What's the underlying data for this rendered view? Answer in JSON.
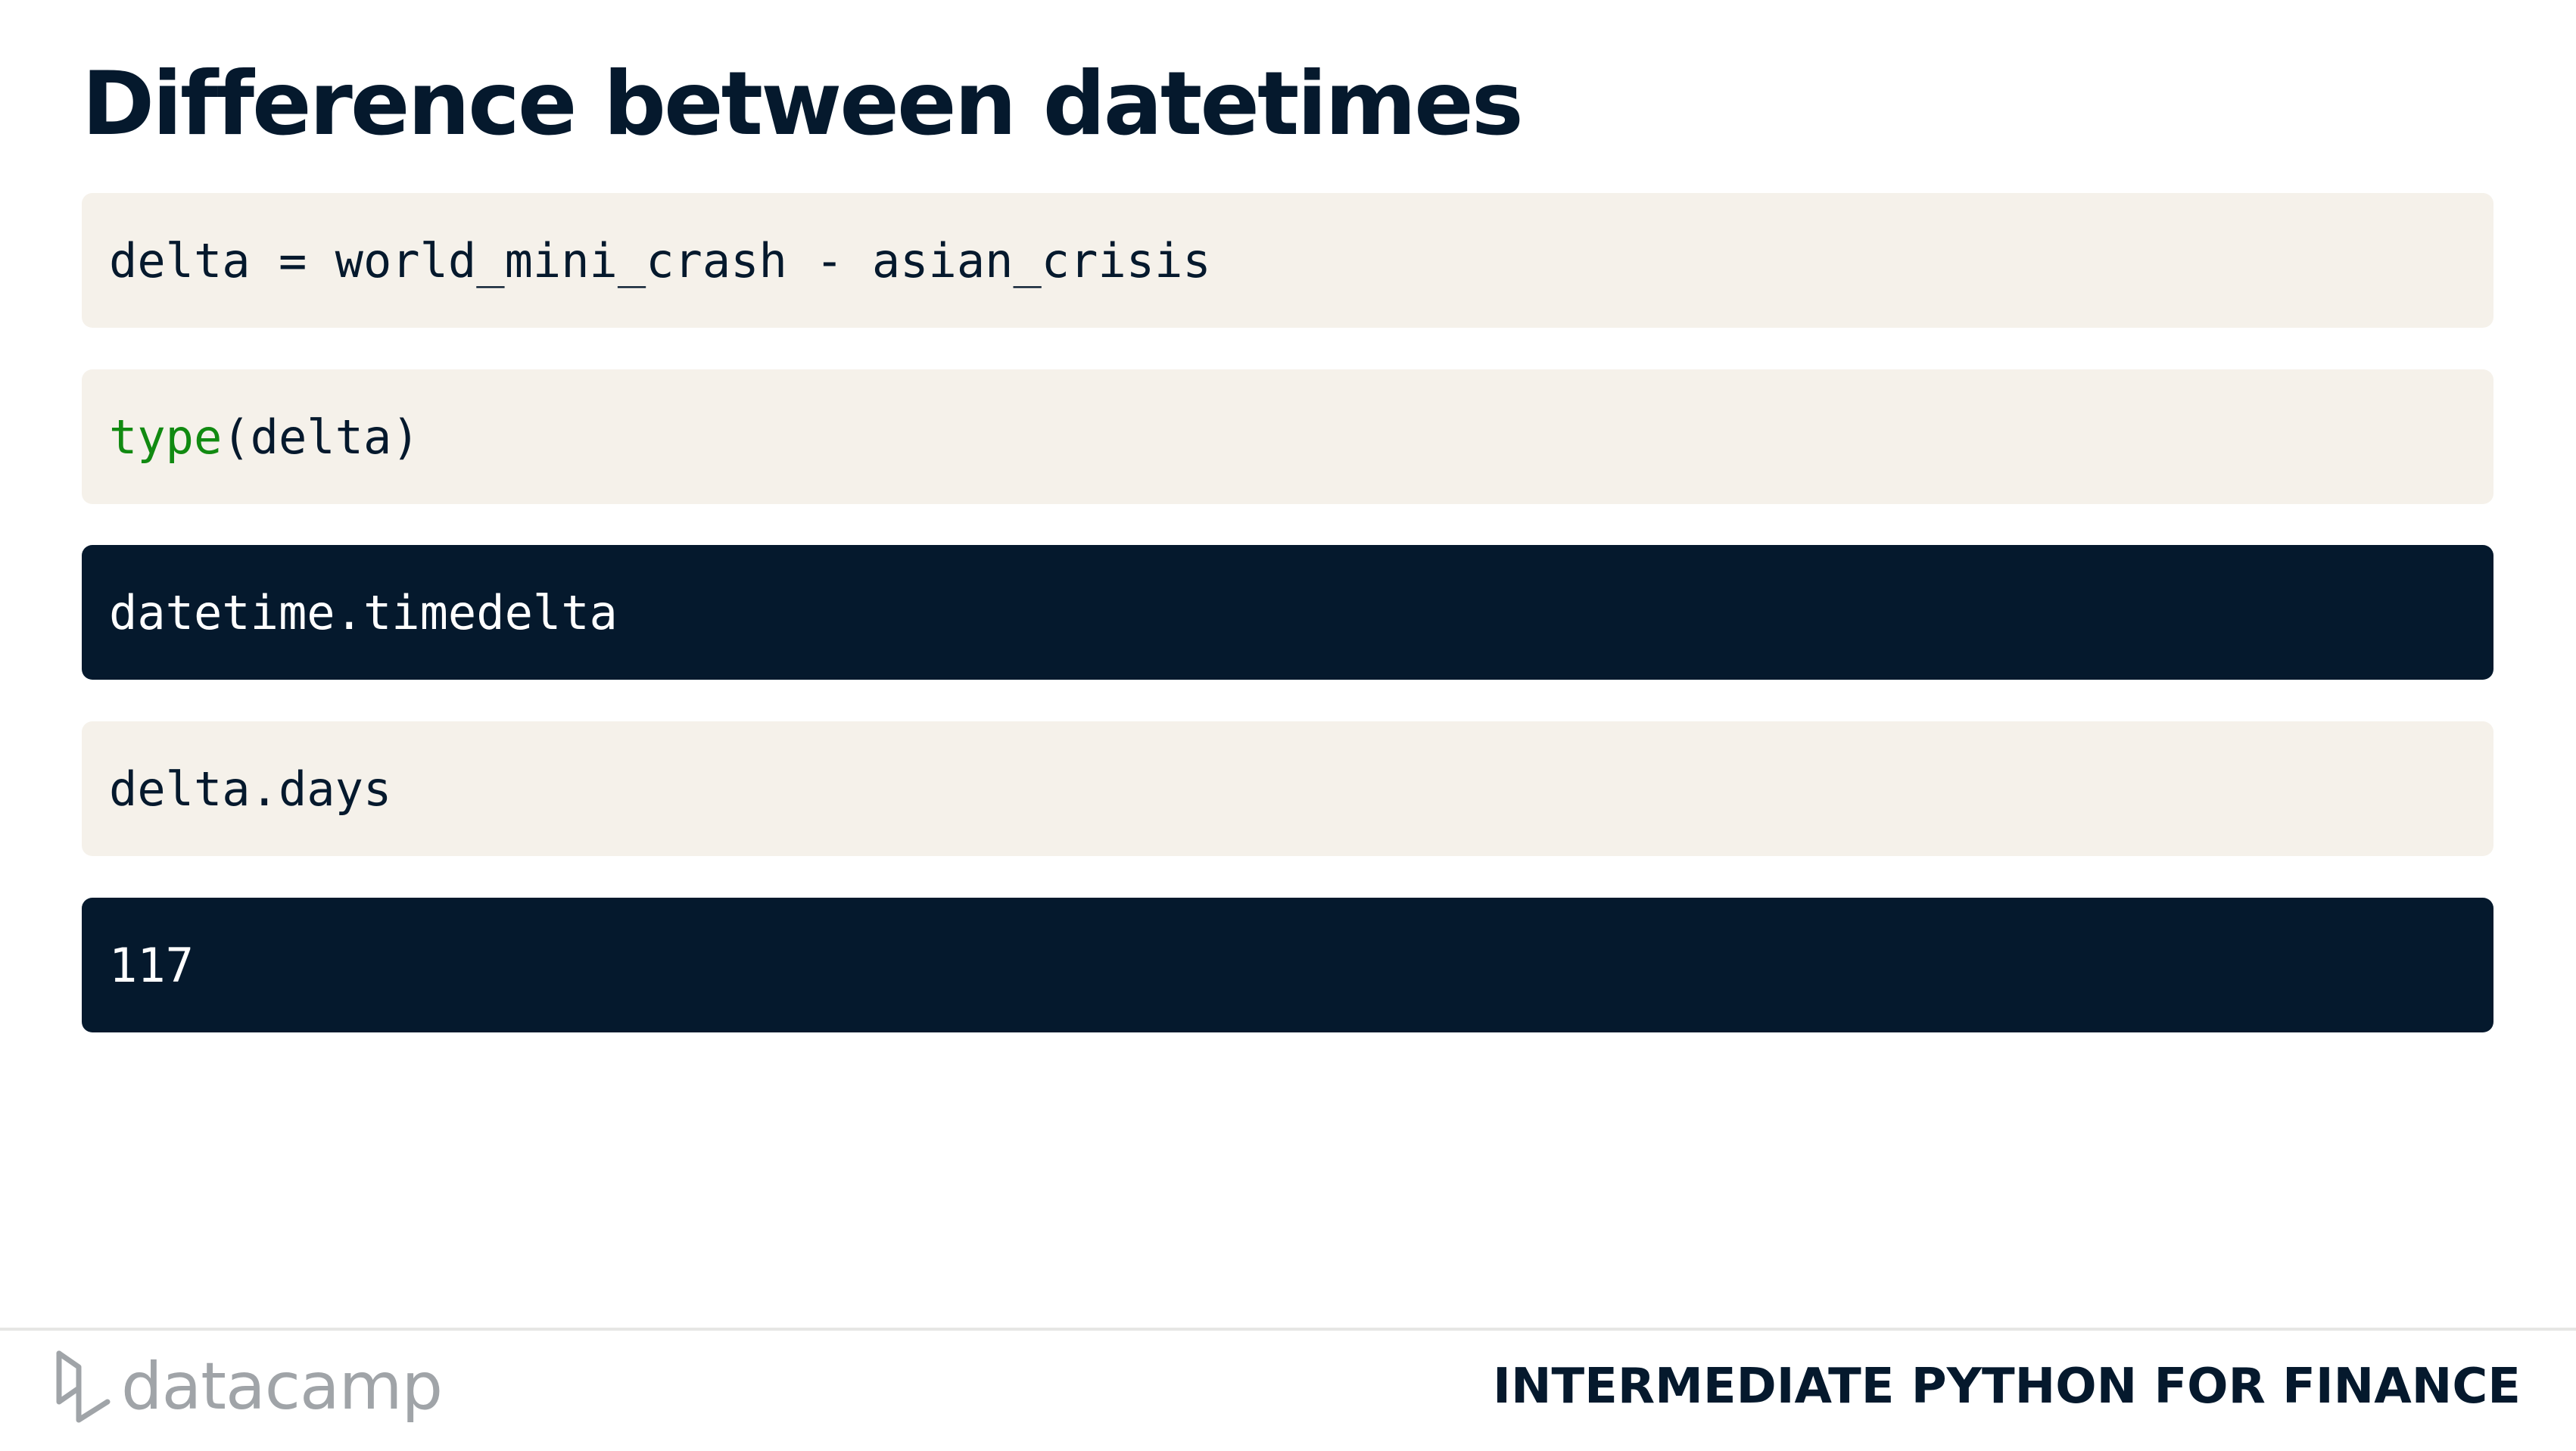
{
  "slide": {
    "title": "Difference between datetimes"
  },
  "blocks": [
    {
      "kind": "code",
      "text": "delta = world_mini_crash - asian_crisis"
    },
    {
      "kind": "code",
      "keyword": "type",
      "rest": "(delta)"
    },
    {
      "kind": "output",
      "text": "datetime.timedelta"
    },
    {
      "kind": "code",
      "text": "delta.days"
    },
    {
      "kind": "output",
      "text": "117"
    }
  ],
  "footer": {
    "logo_text": "datacamp",
    "course_title": "INTERMEDIATE PYTHON FOR FINANCE"
  },
  "colors": {
    "navy": "#05192d",
    "code_bg": "#f5f1ea",
    "keyword_green": "#118a11",
    "logo_gray": "#a0a4a8"
  },
  "icons": {
    "logo": "datacamp-logo-icon"
  }
}
